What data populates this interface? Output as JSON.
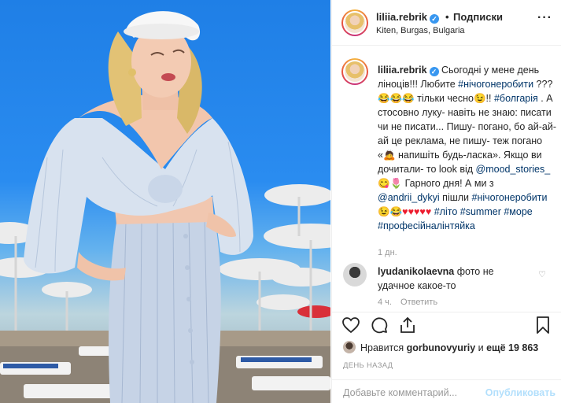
{
  "post": {
    "username": "liliia.rebrik",
    "verified_mark": "✓",
    "dot": "•",
    "follow_label": "Подписки",
    "location": "Kiten, Burgas, Bulgaria",
    "more_icon": "more-horizontal-icon",
    "more_glyph": "···"
  },
  "caption": {
    "username": "liliia.rebrik",
    "t1": "Сьогодні у мене день ліноців!!! Любите ",
    "tag1": "#нічогонеробити",
    "t2": " ???😂😂😂 тільки чесно😉!! ",
    "tag2": "#болгарія",
    "t3": " . А стосовно луку- навіть не знаю: писати чи не писати... Пишу- погано, бо ай-ай-ай це реклама, не пишу- теж погано «🙇 напишіть будь-ласка». Якщо ви дочитали- то look від ",
    "mention1": "@mood_stories_",
    "t4": " 😋🌷 Гарного дня! А ми з ",
    "mention2": "@andrii_dykyi",
    "t5": " пішли ",
    "tag3": "#нічогонеробити",
    "t6": " 😉😂",
    "hearts": "♥♥♥♥♥",
    "tag4": "#літо",
    "tag5": "#summer",
    "tag6": "#море",
    "tag7": "#професійналінтяйка",
    "time": "1 дн."
  },
  "comment": {
    "username": "lyudanikolaevna",
    "text": "фото не удачное какое-то",
    "heart_glyph": "♡",
    "time": "4 ч.",
    "reply_label": "Ответить"
  },
  "actions": {
    "like_icon": "heart-icon",
    "comment_icon": "comment-icon",
    "share_icon": "share-icon",
    "save_icon": "bookmark-icon"
  },
  "likes": {
    "prefix": "Нравится ",
    "user": "gorbunovyuriy",
    "middle": " и ",
    "count": "ещё 19 863"
  },
  "date_label": "ДЕНЬ НАЗАД",
  "add_comment": {
    "placeholder": "Добавьте комментарий...",
    "publish_label": "Опубликовать"
  },
  "colors": {
    "accent": "#3897f0",
    "link": "#003569",
    "heart": "#ed1c2e",
    "muted": "#999999"
  }
}
